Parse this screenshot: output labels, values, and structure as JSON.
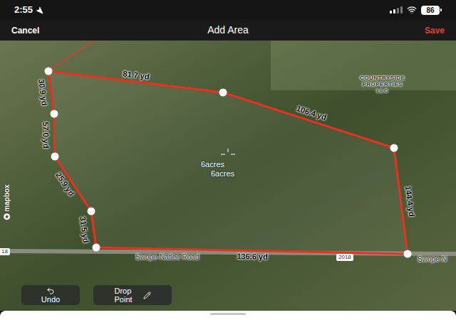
{
  "status_bar": {
    "time": "2:55",
    "battery": "86"
  },
  "header": {
    "cancel": "Cancel",
    "title": "Add Area",
    "save": "Save"
  },
  "map": {
    "edges": [
      {
        "label": "81.7 yd"
      },
      {
        "label": "106.4 yd"
      },
      {
        "label": "144.4 yd"
      },
      {
        "label": "136.6 yd"
      },
      {
        "label": "31.5 yd"
      },
      {
        "label": "25.9 yd"
      },
      {
        "label": "57.0 yd"
      },
      {
        "label": "30.9 yd"
      }
    ],
    "area_labels": [
      "6acres",
      "6acres"
    ],
    "place_label": [
      "COUNTRYSIDE",
      "PROPERTIES",
      "LLC"
    ],
    "road_label": "Swope-Natlee Road",
    "road_label_cut": "Swope-N",
    "road_badges": [
      "2018",
      "18"
    ],
    "attribution": "mapbox"
  },
  "buttons": [
    {
      "label": "Undo"
    },
    {
      "label": "Drop Point"
    }
  ]
}
